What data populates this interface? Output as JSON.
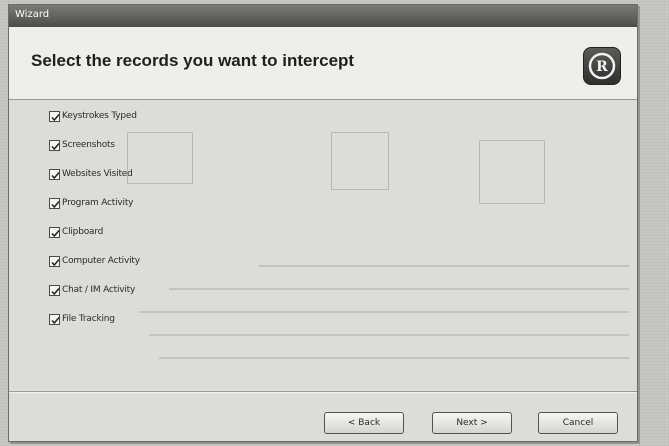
{
  "window": {
    "title": "Wizard"
  },
  "header": {
    "title": "Select the records you want to intercept",
    "logo_icon": "rc-logo-icon"
  },
  "records": [
    {
      "label": "Keystrokes Typed",
      "checked": true
    },
    {
      "label": "Screenshots",
      "checked": true
    },
    {
      "label": "Websites Visited",
      "checked": true
    },
    {
      "label": "Program Activity",
      "checked": true
    },
    {
      "label": "Clipboard",
      "checked": true
    },
    {
      "label": "Computer Activity",
      "checked": true
    },
    {
      "label": "Chat / IM Activity",
      "checked": true
    },
    {
      "label": "File Tracking",
      "checked": true
    }
  ],
  "footer": {
    "back_label": "< Back",
    "next_label": "Next >",
    "cancel_label": "Cancel"
  }
}
